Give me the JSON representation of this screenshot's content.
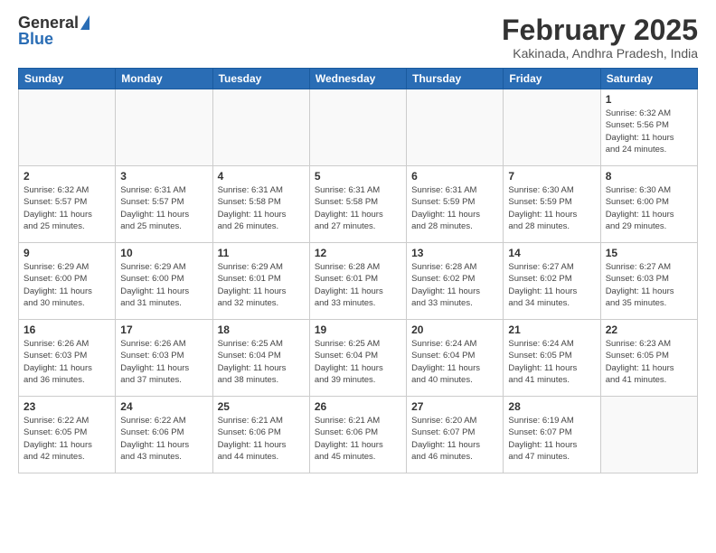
{
  "header": {
    "logo_general": "General",
    "logo_blue": "Blue",
    "title": "February 2025",
    "location": "Kakinada, Andhra Pradesh, India"
  },
  "days_of_week": [
    "Sunday",
    "Monday",
    "Tuesday",
    "Wednesday",
    "Thursday",
    "Friday",
    "Saturday"
  ],
  "weeks": [
    [
      {
        "day": "",
        "info": ""
      },
      {
        "day": "",
        "info": ""
      },
      {
        "day": "",
        "info": ""
      },
      {
        "day": "",
        "info": ""
      },
      {
        "day": "",
        "info": ""
      },
      {
        "day": "",
        "info": ""
      },
      {
        "day": "1",
        "info": "Sunrise: 6:32 AM\nSunset: 5:56 PM\nDaylight: 11 hours\nand 24 minutes."
      }
    ],
    [
      {
        "day": "2",
        "info": "Sunrise: 6:32 AM\nSunset: 5:57 PM\nDaylight: 11 hours\nand 25 minutes."
      },
      {
        "day": "3",
        "info": "Sunrise: 6:31 AM\nSunset: 5:57 PM\nDaylight: 11 hours\nand 25 minutes."
      },
      {
        "day": "4",
        "info": "Sunrise: 6:31 AM\nSunset: 5:58 PM\nDaylight: 11 hours\nand 26 minutes."
      },
      {
        "day": "5",
        "info": "Sunrise: 6:31 AM\nSunset: 5:58 PM\nDaylight: 11 hours\nand 27 minutes."
      },
      {
        "day": "6",
        "info": "Sunrise: 6:31 AM\nSunset: 5:59 PM\nDaylight: 11 hours\nand 28 minutes."
      },
      {
        "day": "7",
        "info": "Sunrise: 6:30 AM\nSunset: 5:59 PM\nDaylight: 11 hours\nand 28 minutes."
      },
      {
        "day": "8",
        "info": "Sunrise: 6:30 AM\nSunset: 6:00 PM\nDaylight: 11 hours\nand 29 minutes."
      }
    ],
    [
      {
        "day": "9",
        "info": "Sunrise: 6:29 AM\nSunset: 6:00 PM\nDaylight: 11 hours\nand 30 minutes."
      },
      {
        "day": "10",
        "info": "Sunrise: 6:29 AM\nSunset: 6:00 PM\nDaylight: 11 hours\nand 31 minutes."
      },
      {
        "day": "11",
        "info": "Sunrise: 6:29 AM\nSunset: 6:01 PM\nDaylight: 11 hours\nand 32 minutes."
      },
      {
        "day": "12",
        "info": "Sunrise: 6:28 AM\nSunset: 6:01 PM\nDaylight: 11 hours\nand 33 minutes."
      },
      {
        "day": "13",
        "info": "Sunrise: 6:28 AM\nSunset: 6:02 PM\nDaylight: 11 hours\nand 33 minutes."
      },
      {
        "day": "14",
        "info": "Sunrise: 6:27 AM\nSunset: 6:02 PM\nDaylight: 11 hours\nand 34 minutes."
      },
      {
        "day": "15",
        "info": "Sunrise: 6:27 AM\nSunset: 6:03 PM\nDaylight: 11 hours\nand 35 minutes."
      }
    ],
    [
      {
        "day": "16",
        "info": "Sunrise: 6:26 AM\nSunset: 6:03 PM\nDaylight: 11 hours\nand 36 minutes."
      },
      {
        "day": "17",
        "info": "Sunrise: 6:26 AM\nSunset: 6:03 PM\nDaylight: 11 hours\nand 37 minutes."
      },
      {
        "day": "18",
        "info": "Sunrise: 6:25 AM\nSunset: 6:04 PM\nDaylight: 11 hours\nand 38 minutes."
      },
      {
        "day": "19",
        "info": "Sunrise: 6:25 AM\nSunset: 6:04 PM\nDaylight: 11 hours\nand 39 minutes."
      },
      {
        "day": "20",
        "info": "Sunrise: 6:24 AM\nSunset: 6:04 PM\nDaylight: 11 hours\nand 40 minutes."
      },
      {
        "day": "21",
        "info": "Sunrise: 6:24 AM\nSunset: 6:05 PM\nDaylight: 11 hours\nand 41 minutes."
      },
      {
        "day": "22",
        "info": "Sunrise: 6:23 AM\nSunset: 6:05 PM\nDaylight: 11 hours\nand 41 minutes."
      }
    ],
    [
      {
        "day": "23",
        "info": "Sunrise: 6:22 AM\nSunset: 6:05 PM\nDaylight: 11 hours\nand 42 minutes."
      },
      {
        "day": "24",
        "info": "Sunrise: 6:22 AM\nSunset: 6:06 PM\nDaylight: 11 hours\nand 43 minutes."
      },
      {
        "day": "25",
        "info": "Sunrise: 6:21 AM\nSunset: 6:06 PM\nDaylight: 11 hours\nand 44 minutes."
      },
      {
        "day": "26",
        "info": "Sunrise: 6:21 AM\nSunset: 6:06 PM\nDaylight: 11 hours\nand 45 minutes."
      },
      {
        "day": "27",
        "info": "Sunrise: 6:20 AM\nSunset: 6:07 PM\nDaylight: 11 hours\nand 46 minutes."
      },
      {
        "day": "28",
        "info": "Sunrise: 6:19 AM\nSunset: 6:07 PM\nDaylight: 11 hours\nand 47 minutes."
      },
      {
        "day": "",
        "info": ""
      }
    ]
  ]
}
